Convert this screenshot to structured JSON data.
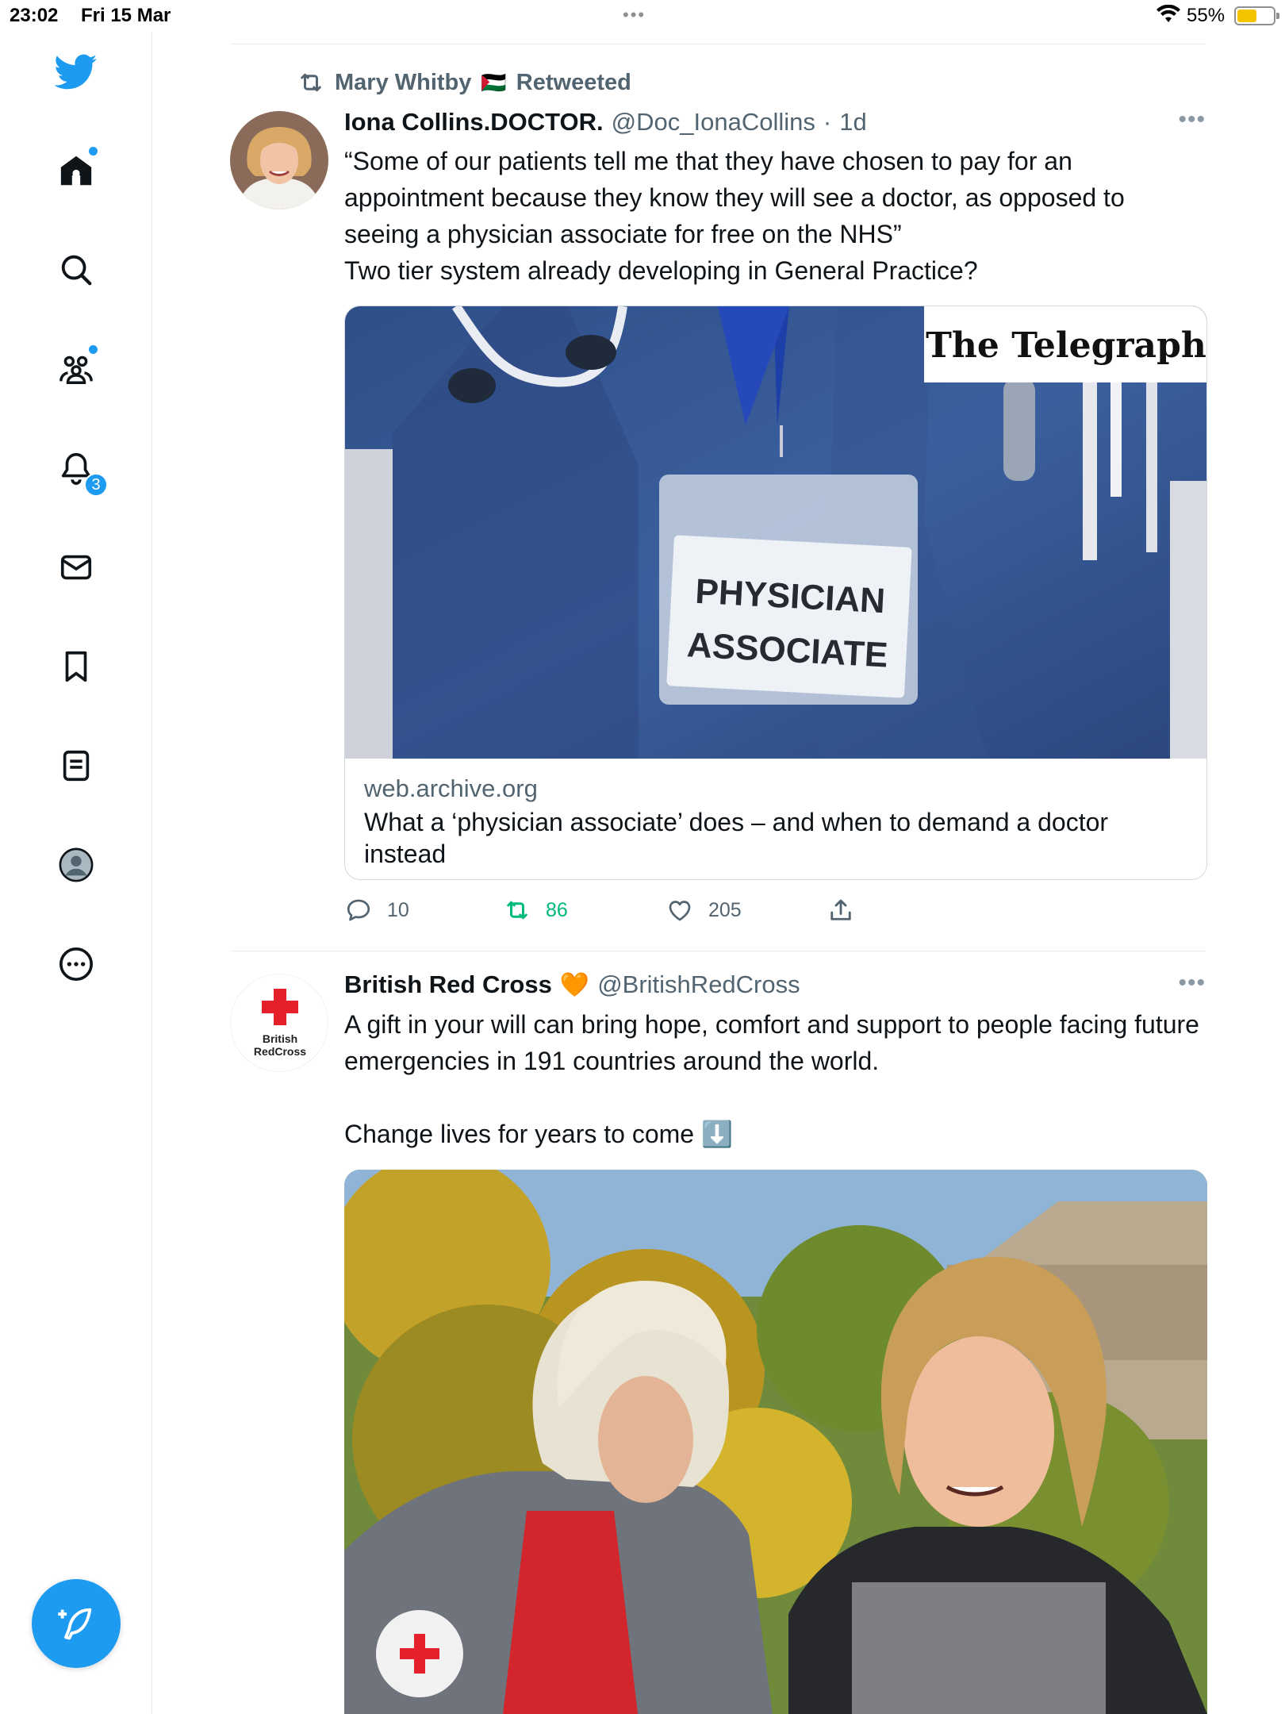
{
  "status_bar": {
    "time": "23:02",
    "date": "Fri 15 Mar",
    "battery": "55%",
    "battery_level": 0.55,
    "multitask_dots": "•••"
  },
  "sidebar": {
    "items": [
      {
        "name": "twitter-logo",
        "icon": "bird-icon"
      },
      {
        "name": "home",
        "icon": "home-icon",
        "has_dot": true
      },
      {
        "name": "explore",
        "icon": "search-icon"
      },
      {
        "name": "communities",
        "icon": "communities-icon",
        "has_dot": true
      },
      {
        "name": "notifications",
        "icon": "bell-icon",
        "badge": "3"
      },
      {
        "name": "messages",
        "icon": "envelope-icon"
      },
      {
        "name": "bookmarks",
        "icon": "bookmark-icon"
      },
      {
        "name": "lists",
        "icon": "list-icon"
      },
      {
        "name": "profile",
        "icon": "profile-avatar-icon"
      },
      {
        "name": "more",
        "icon": "more-circle-icon"
      }
    ],
    "compose_icon": "compose-feather-icon"
  },
  "tweets": [
    {
      "retweeted_by": "Mary Whitby",
      "retweeted_flag": "🇵🇸",
      "retweet_label": "Retweeted",
      "author_name": "Iona Collins.DOCTOR.",
      "handle": "@Doc_IonaCollins",
      "separator": "·",
      "time": "1d",
      "text": "“Some of our patients tell me that they have chosen to pay for an appointment because they know they will see a doctor, as opposed to seeing a physician associate for free on the NHS”\nTwo tier system already developing in General Practice?",
      "card": {
        "brand": "The Telegraph",
        "badge_line1": "PHYSICIAN",
        "badge_line2": "ASSOCIATE",
        "domain": "web.archive.org",
        "title": "What a ‘physician associate’ does – and when to demand a doctor instead"
      },
      "replies": "10",
      "retweets": "86",
      "likes": "205"
    },
    {
      "author_name": "British Red Cross",
      "author_emoji": "🧡",
      "handle": "@BritishRedCross",
      "avatar_text_line1": "British",
      "avatar_text_line2": "RedCross",
      "text": "A gift in your will can bring hope, comfort and support to people facing future emergencies in 191 countries around the world.\n\nChange lives for years to come ⬇️"
    }
  ],
  "colors": {
    "accent": "#1d9bf0",
    "retweet_green": "#00ba7c",
    "secondary_text": "#536471",
    "red_cross": "#e4202a"
  }
}
